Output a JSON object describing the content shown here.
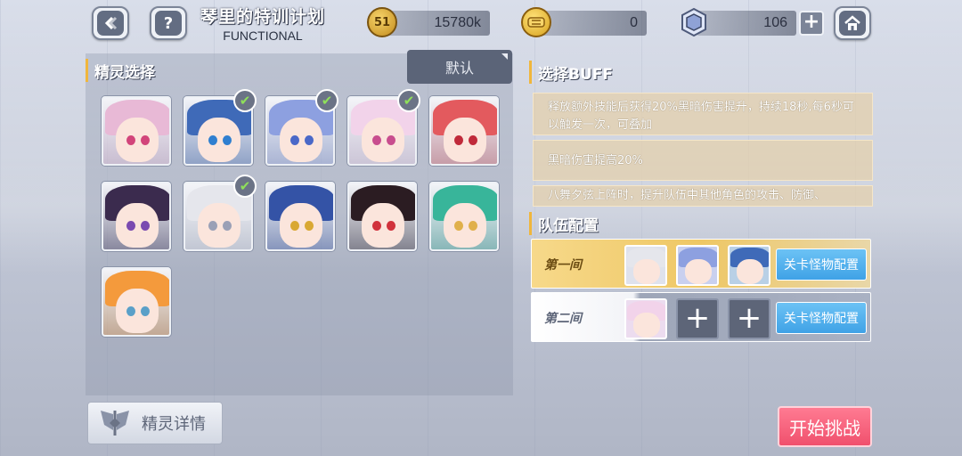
{
  "header": {
    "title": "琴里的特训计划",
    "subtitle": "FUNCTIONAL",
    "back_icon": "back-arrow-icon",
    "help_icon": "question-icon",
    "home_icon": "home-icon"
  },
  "resources": {
    "coin_glyph": "51",
    "coin_value": "15780k",
    "gold_value": "0",
    "crystal_value": "106",
    "plus": "+"
  },
  "spirit_select": {
    "heading": "精灵选择",
    "default_label": "默认",
    "spirits": [
      {
        "hair": "#e8b9d6",
        "eye": "#d2447a",
        "checked": false
      },
      {
        "hair": "#3f6ab8",
        "eye": "#2f7fd0",
        "checked": true
      },
      {
        "hair": "#8da0e0",
        "eye": "#4a68c8",
        "checked": true
      },
      {
        "hair": "#f2d3ea",
        "eye": "#c84d8e",
        "checked": true
      },
      {
        "hair": "#e35a5e",
        "eye": "#c02a3a",
        "checked": false
      },
      {
        "hair": "#3b2b4e",
        "eye": "#7a4ab0",
        "checked": false
      },
      {
        "hair": "#e5e6ec",
        "eye": "#9aa0b6",
        "checked": true
      },
      {
        "hair": "#3453a6",
        "eye": "#d9a833",
        "checked": false
      },
      {
        "hair": "#2b1c22",
        "eye": "#d1323c",
        "checked": false
      },
      {
        "hair": "#38b59a",
        "eye": "#e0b04b",
        "checked": false
      },
      {
        "hair": "#f49a3c",
        "eye": "#5aa0c8",
        "checked": false
      }
    ],
    "detail_label": "精灵详情"
  },
  "buff": {
    "heading": "选择BUFF",
    "items": [
      "释放额外技能后获得20%黑暗伤害提升，持续18秒,每6秒可以触发一次，可叠加",
      "黑暗伤害提高20%",
      "八舞夕弦上阵时，提升队伍中其他角色的攻击、防御、"
    ]
  },
  "team": {
    "heading": "队伍配置",
    "rows": [
      {
        "label": "第一间",
        "config_label": "关卡怪物配置"
      },
      {
        "label": "第二间",
        "config_label": "关卡怪物配置"
      }
    ],
    "add_symbol": "+"
  },
  "start_label": "开始挑战",
  "colors": {
    "accent": "#f0b63c",
    "config_blue": "#3fa2e6",
    "start_pink": "#f0506d"
  }
}
